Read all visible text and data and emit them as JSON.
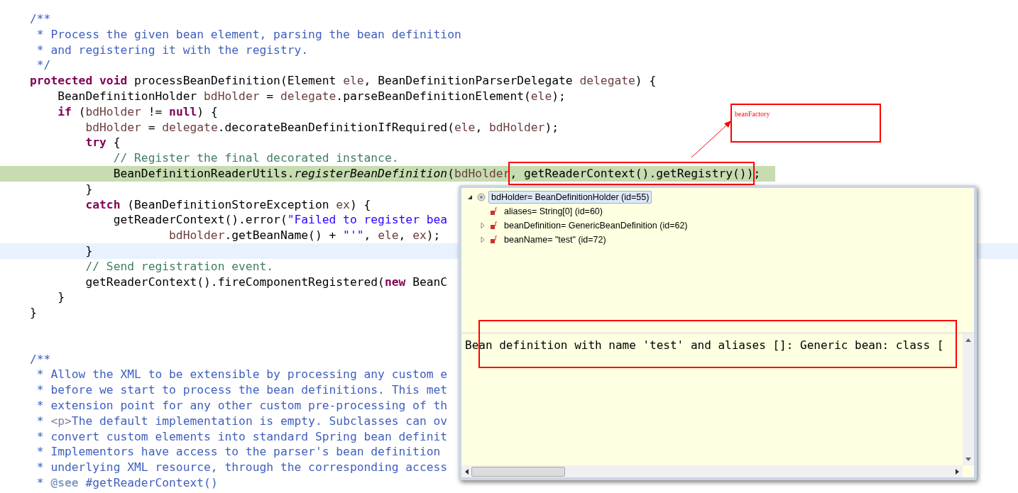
{
  "editor": {
    "lines": [
      {
        "kind": "plain",
        "tokens": [
          {
            "kind": "doc",
            "text": "/**"
          }
        ]
      },
      {
        "kind": "plain",
        "tokens": [
          {
            "kind": "doc",
            "text": " * Process the given bean element, parsing the bean definition"
          }
        ]
      },
      {
        "kind": "plain",
        "tokens": [
          {
            "kind": "doc",
            "text": " * and registering it with the registry."
          }
        ]
      },
      {
        "kind": "plain",
        "tokens": [
          {
            "kind": "doc",
            "text": " */"
          }
        ]
      },
      {
        "kind": "plain",
        "tokens": [
          {
            "kind": "kw",
            "text": "protected "
          },
          {
            "kind": "kw",
            "text": "void"
          },
          {
            "kind": "plain",
            "text": " processBeanDefinition(Element "
          },
          {
            "kind": "var",
            "text": "ele"
          },
          {
            "kind": "plain",
            "text": ", BeanDefinitionParserDelegate "
          },
          {
            "kind": "var",
            "text": "delegate"
          },
          {
            "kind": "plain",
            "text": ") {"
          }
        ]
      },
      {
        "kind": "plain",
        "tokens": [
          {
            "kind": "plain",
            "text": "    BeanDefinitionHolder "
          },
          {
            "kind": "var",
            "text": "bdHolder"
          },
          {
            "kind": "plain",
            "text": " = "
          },
          {
            "kind": "var",
            "text": "delegate"
          },
          {
            "kind": "plain",
            "text": ".parseBeanDefinitionElement("
          },
          {
            "kind": "var",
            "text": "ele"
          },
          {
            "kind": "plain",
            "text": ");"
          }
        ]
      },
      {
        "kind": "plain",
        "tokens": [
          {
            "kind": "kw",
            "text": "    if"
          },
          {
            "kind": "plain",
            "text": " ("
          },
          {
            "kind": "var",
            "text": "bdHolder"
          },
          {
            "kind": "plain",
            "text": " != "
          },
          {
            "kind": "kw",
            "text": "null"
          },
          {
            "kind": "plain",
            "text": ") {"
          }
        ]
      },
      {
        "kind": "plain",
        "tokens": [
          {
            "kind": "var",
            "text": "        bdHolder"
          },
          {
            "kind": "plain",
            "text": " = "
          },
          {
            "kind": "var",
            "text": "delegate"
          },
          {
            "kind": "plain",
            "text": ".decorateBeanDefinitionIfRequired("
          },
          {
            "kind": "var",
            "text": "ele"
          },
          {
            "kind": "plain",
            "text": ", "
          },
          {
            "kind": "var",
            "text": "bdHolder"
          },
          {
            "kind": "plain",
            "text": ");"
          }
        ]
      },
      {
        "kind": "plain",
        "tokens": [
          {
            "kind": "kw",
            "text": "        try"
          },
          {
            "kind": "plain",
            "text": " {"
          }
        ]
      },
      {
        "kind": "plain",
        "tokens": [
          {
            "kind": "comment",
            "text": "            // Register the final decorated instance."
          }
        ]
      },
      {
        "kind": "debug",
        "tokens": [
          {
            "kind": "plain",
            "text": "            BeanDefinitionReaderUtils."
          },
          {
            "kind": "italic",
            "text": "registerBeanDefinition"
          },
          {
            "kind": "plain",
            "text": "("
          },
          {
            "kind": "var",
            "text": "bdHolder"
          },
          {
            "kind": "plain",
            "text": ", getReaderContext().getRegistry())",
            "boxed": true
          },
          {
            "kind": "plain",
            "text": ";"
          }
        ]
      },
      {
        "kind": "plain",
        "tokens": [
          {
            "kind": "plain",
            "text": "        }"
          }
        ]
      },
      {
        "kind": "plain",
        "tokens": [
          {
            "kind": "kw",
            "text": "        catch"
          },
          {
            "kind": "plain",
            "text": " (BeanDefinitionStoreException "
          },
          {
            "kind": "var",
            "text": "ex"
          },
          {
            "kind": "plain",
            "text": ") {"
          }
        ]
      },
      {
        "kind": "plain",
        "tokens": [
          {
            "kind": "plain",
            "text": "            getReaderContext().error("
          },
          {
            "kind": "string",
            "text": "\"Failed to register bea"
          }
        ]
      },
      {
        "kind": "plain",
        "tokens": [
          {
            "kind": "var",
            "text": "                    bdHolder"
          },
          {
            "kind": "plain",
            "text": ".getBeanName() + "
          },
          {
            "kind": "string",
            "text": "\"'\""
          },
          {
            "kind": "plain",
            "text": ", "
          },
          {
            "kind": "var",
            "text": "ele"
          },
          {
            "kind": "plain",
            "text": ", "
          },
          {
            "kind": "var",
            "text": "ex"
          },
          {
            "kind": "plain",
            "text": ");"
          }
        ]
      },
      {
        "kind": "cursor",
        "tokens": [
          {
            "kind": "plain",
            "text": "        }"
          }
        ]
      },
      {
        "kind": "plain",
        "tokens": [
          {
            "kind": "comment",
            "text": "        // Send registration event."
          }
        ]
      },
      {
        "kind": "plain",
        "tokens": [
          {
            "kind": "plain",
            "text": "        getReaderContext().fireComponentRegistered("
          },
          {
            "kind": "kw",
            "text": "new"
          },
          {
            "kind": "plain",
            "text": " BeanC"
          }
        ]
      },
      {
        "kind": "plain",
        "tokens": [
          {
            "kind": "plain",
            "text": "    }"
          }
        ]
      },
      {
        "kind": "plain",
        "tokens": [
          {
            "kind": "plain",
            "text": "}"
          }
        ]
      },
      {
        "kind": "plain"
      },
      {
        "kind": "plain"
      },
      {
        "kind": "plain",
        "tokens": [
          {
            "kind": "doc",
            "text": "/**"
          }
        ]
      },
      {
        "kind": "plain",
        "tokens": [
          {
            "kind": "doc",
            "text": " * Allow the XML to be extensible by processing any custom e"
          }
        ]
      },
      {
        "kind": "plain",
        "tokens": [
          {
            "kind": "doc",
            "text": " * before we start to process the bean definitions. This met"
          }
        ]
      },
      {
        "kind": "plain",
        "tokens": [
          {
            "kind": "doc",
            "text": " * extension point for any other custom pre-processing of th"
          }
        ]
      },
      {
        "kind": "plain",
        "tokens": [
          {
            "kind": "doc",
            "text": " * "
          },
          {
            "kind": "tag",
            "text": "<p>"
          },
          {
            "kind": "doc",
            "text": "The default implementation is empty. Subclasses can ov"
          }
        ]
      },
      {
        "kind": "plain",
        "tokens": [
          {
            "kind": "doc",
            "text": " * convert custom elements into standard Spring bean definit"
          }
        ]
      },
      {
        "kind": "plain",
        "tokens": [
          {
            "kind": "doc",
            "text": " * Implementors have access to the parser's bean definition"
          }
        ]
      },
      {
        "kind": "plain",
        "tokens": [
          {
            "kind": "doc",
            "text": " * underlying XML resource, through the corresponding access"
          }
        ]
      },
      {
        "kind": "plain",
        "tokens": [
          {
            "kind": "doc",
            "text": " * "
          },
          {
            "kind": "doctag",
            "text": "@see"
          },
          {
            "kind": "doc",
            "text": " #getReaderContext()"
          }
        ]
      }
    ]
  },
  "annotation": {
    "note": "beanFactory"
  },
  "inspector": {
    "tree": [
      {
        "label": "bdHolder= BeanDefinitionHolder  (id=55)",
        "kind": "object",
        "selected": true,
        "expandable": true,
        "expanded": true,
        "children": [
          {
            "label": "aliases= String[0]  (id=60)",
            "kind": "field",
            "selected": false,
            "expandable": false,
            "expanded": false
          },
          {
            "label": "beanDefinition= GenericBeanDefinition  (id=62)",
            "kind": "field",
            "selected": false,
            "expandable": true,
            "expanded": false
          },
          {
            "label": "beanName= \"test\" (id=72)",
            "kind": "field",
            "selected": false,
            "expandable": true,
            "expanded": false
          }
        ]
      }
    ],
    "detail": "Bean definition with name 'test' and aliases []: Generic bean: class ["
  }
}
